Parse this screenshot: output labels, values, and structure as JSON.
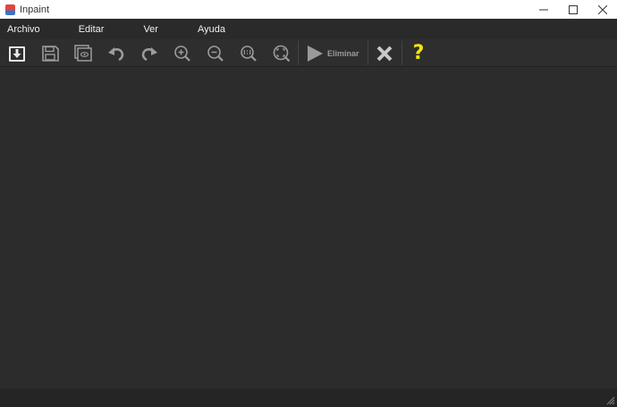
{
  "window": {
    "title": "Inpaint",
    "minimize_glyph": "—",
    "maximize_glyph": "☐",
    "close_glyph": "✕"
  },
  "menu": {
    "items": [
      {
        "label": "Archivo"
      },
      {
        "label": "Editar"
      },
      {
        "label": "Ver"
      },
      {
        "label": "Ayuda"
      }
    ]
  },
  "toolbar": {
    "run_label": "Eliminar",
    "help_glyph": "?",
    "icons": [
      "open-icon",
      "save-icon",
      "view-original-icon",
      "undo-icon",
      "redo-icon",
      "zoom-in-icon",
      "zoom-out-icon",
      "actual-size-icon",
      "fit-to-window-icon",
      "play-icon",
      "cancel-icon",
      "help-icon"
    ]
  },
  "colors": {
    "background": "#2b2b2b",
    "toolbar": "#2e2e2e",
    "icon": "#b0b0b0",
    "help": "#f5e60c",
    "cancel": "#c8c8c8"
  }
}
